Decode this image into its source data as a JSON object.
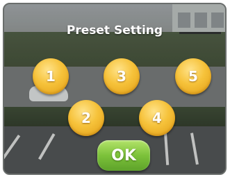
{
  "dialog": {
    "title": "Preset Setting"
  },
  "presets": [
    {
      "label": "1"
    },
    {
      "label": "2"
    },
    {
      "label": "3"
    },
    {
      "label": "4"
    },
    {
      "label": "5"
    }
  ],
  "ok_button": {
    "label": "OK"
  },
  "colors": {
    "preset_button": "#f6c23a",
    "ok_button": "#7cc23a",
    "title_text": "#ffffff"
  }
}
